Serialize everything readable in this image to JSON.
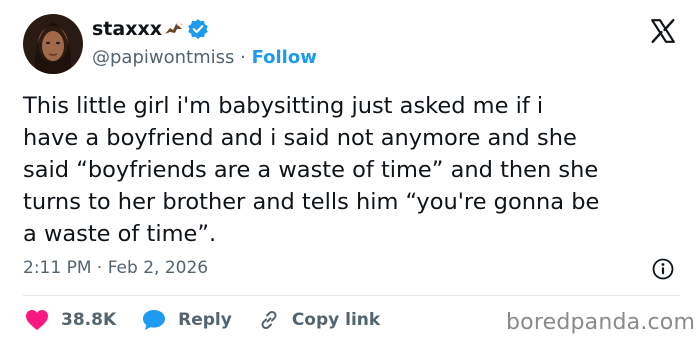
{
  "user": {
    "display_name": "staxxx",
    "handle": "@papiwontmiss",
    "separator": "·",
    "follow_label": "Follow"
  },
  "tweet": {
    "text": "This little girl i'm babysitting just asked me if i\nhave a boyfriend and i said not anymore and she\nsaid “boyfriends are a waste of time” and then she\nturns to her brother and tells him “you're gonna be\na waste of time”.",
    "timestamp": "2:11 PM · Feb 2, 2026"
  },
  "actions": {
    "like_count": "38.8K",
    "reply_label": "Reply",
    "copy_link_label": "Copy link"
  },
  "watermark": "boredpanda.com",
  "colors": {
    "accent": "#1d9bf0",
    "like": "#f91880",
    "secondary_text": "#536471"
  },
  "icons": [
    "eagle-emoji-icon",
    "verified-badge-icon",
    "x-logo-icon",
    "info-icon",
    "heart-icon",
    "reply-bubble-icon",
    "link-icon"
  ]
}
